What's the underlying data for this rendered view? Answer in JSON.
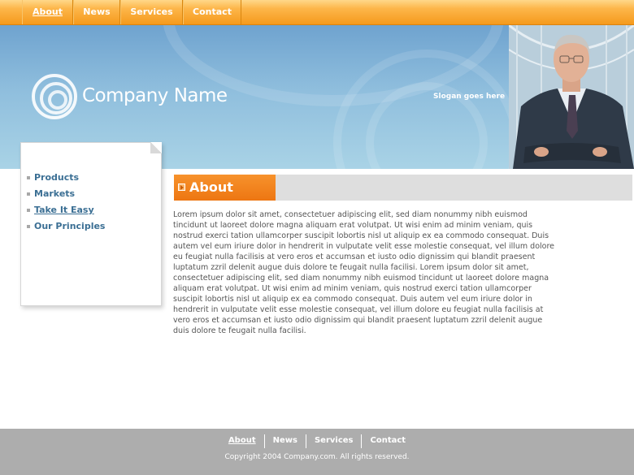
{
  "nav": {
    "items": [
      {
        "label": "About",
        "active": true
      },
      {
        "label": "News",
        "active": false
      },
      {
        "label": "Services",
        "active": false
      },
      {
        "label": "Contact",
        "active": false
      }
    ]
  },
  "header": {
    "company_name": "Company Name",
    "slogan": "Slogan goes here"
  },
  "sidebar": {
    "items": [
      {
        "label": "Products"
      },
      {
        "label": "Markets"
      },
      {
        "label": "Take It Easy",
        "current": true
      },
      {
        "label": "Our Principles"
      }
    ]
  },
  "content": {
    "title": "About",
    "body": "Lorem ipsum dolor sit amet, consectetuer adipiscing elit, sed diam nonummy nibh euismod tincidunt ut laoreet dolore magna aliquam erat volutpat. Ut wisi enim ad minim veniam, quis nostrud exerci tation ullamcorper suscipit lobortis nisl ut aliquip ex ea commodo consequat. Duis autem vel eum iriure dolor in hendrerit in vulputate velit esse molestie consequat, vel illum dolore eu feugiat nulla facilisis at vero eros et accumsan et iusto odio dignissim qui blandit praesent luptatum zzril delenit augue duis dolore te feugait nulla facilisi. Lorem ipsum dolor sit amet, consectetuer adipiscing elit, sed diam nonummy nibh euismod tincidunt ut laoreet dolore magna aliquam erat volutpat. Ut wisi enim ad minim veniam, quis nostrud exerci tation ullamcorper suscipit lobortis nisl ut aliquip ex ea commodo consequat. Duis autem vel eum iriure dolor in hendrerit in vulputate velit esse molestie consequat, vel illum dolore eu feugiat nulla facilisis at vero eros et accumsan et iusto odio dignissim qui blandit praesent luptatum zzril delenit augue duis dolore te feugait nulla facilisi."
  },
  "footer": {
    "items": [
      {
        "label": "About",
        "active": true
      },
      {
        "label": "News",
        "active": false
      },
      {
        "label": "Services",
        "active": false
      },
      {
        "label": "Contact",
        "active": false
      }
    ],
    "copyright": "Copyright 2004 Company.com. All rights reserved."
  },
  "colors": {
    "nav_orange": "#f59a1c",
    "accent_orange": "#ed7612",
    "link_blue": "#3b6f94",
    "footer_gray": "#adadad"
  }
}
